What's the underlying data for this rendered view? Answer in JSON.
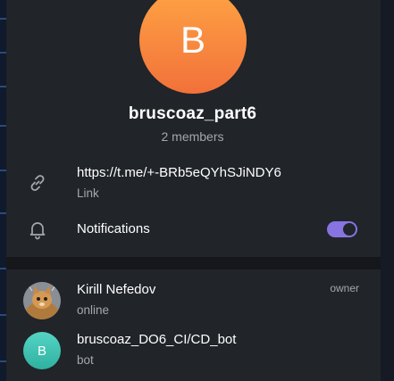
{
  "group": {
    "avatar_letter": "B",
    "name": "bruscoaz_part6",
    "members_count": "2 members",
    "avatar_gradient": [
      "#fea444",
      "#f2713a"
    ]
  },
  "info": {
    "link": {
      "value": "https://t.me/+-BRb5eQYhSJiNDY6",
      "label": "Link",
      "icon": "link-icon"
    },
    "notifications": {
      "label": "Notifications",
      "icon": "bell-icon",
      "enabled": true
    }
  },
  "members": [
    {
      "name": "Kirill Nefedov",
      "status": "online",
      "role": "owner",
      "avatar": "cat-photo"
    },
    {
      "name": "bruscoaz_DO6_CI/CD_bot",
      "status": "bot",
      "avatar_letter": "B",
      "avatar_color": "#3cc0b0"
    }
  ],
  "colors": {
    "accent": "#8774e1",
    "panel": "#212429",
    "secondary_text": "#a4a8ae"
  }
}
